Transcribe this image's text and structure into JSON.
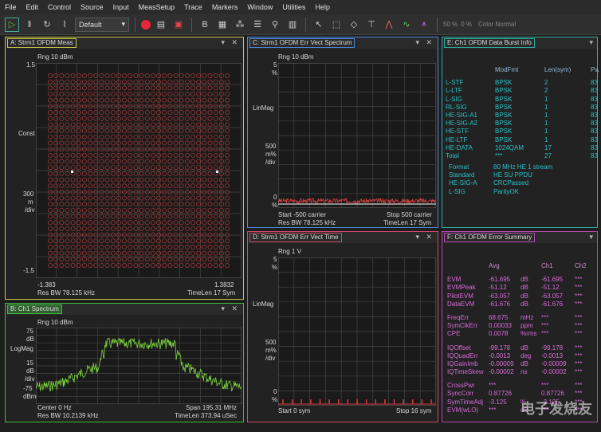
{
  "menu": [
    "File",
    "Edit",
    "Control",
    "Source",
    "Input",
    "MeasSetup",
    "Trace",
    "Markers",
    "Window",
    "Utilities",
    "Help"
  ],
  "toolbar": {
    "preset": "Default",
    "zoom": "50 %",
    "zoom2": "0 %",
    "color": "Color Normal"
  },
  "panelA": {
    "title": "A: Strm1 OFDM Meas",
    "rng": "Rng 10 dBm",
    "y_top": "1.5",
    "y_mid_label": "Const",
    "y_scale1": "300",
    "y_scale2": "m",
    "y_scale3": "/div",
    "y_bot": "-1.5",
    "x_left": "-1.383",
    "x_right": "1.3832",
    "bottom_left": "Res BW 78.125 kHz",
    "bottom_right": "TimeLen 17  Sym"
  },
  "panelB": {
    "title": "B: Ch1 Spectrum",
    "rng": "Rng 10 dBm",
    "y_top": "75",
    "y_top2": "dB",
    "y_mid": "LogMag",
    "y_3": "15",
    "y_4": "dB",
    "y_5": "/div",
    "y_bot": "-75",
    "y_bot2": "dBm",
    "bottom_l1": "Center 0  Hz",
    "bottom_l2": "Res BW 10.2139 kHz",
    "bottom_r1": "Span 195.31 MHz",
    "bottom_r2": "TimeLen 373.94 uSec"
  },
  "panelC": {
    "title": "C: Strm1 OFDM Err Vect Spectrum",
    "rng": "Rng 10 dBm",
    "y_top": "5",
    "y_top2": "%",
    "y_mid": "LinMag",
    "y_3": "500",
    "y_4": "m%",
    "y_5": "/div",
    "y_bot": "0",
    "y_bot2": "%",
    "bl1": "Start -500  carrier",
    "bl2": "Res BW 78.125 kHz",
    "br1": "Stop 500  carrier",
    "br2": "TimeLen 17  Sym"
  },
  "panelD": {
    "title": "D: Strm1 OFDM Err Vect Time",
    "rng": "Rng 1  V",
    "y_top": "5",
    "y_top2": "%",
    "y_mid": "LinMag",
    "y_3": "500",
    "y_4": "m%",
    "y_5": "/div",
    "y_bot": "0",
    "y_bot2": "%",
    "bl": "Start 0  sym",
    "br": "Stop 16  sym"
  },
  "panelE": {
    "title": "E: Ch1 OFDM Data Burst Info",
    "headers": [
      "",
      "ModFmt",
      "Len(sym)",
      "Pw"
    ],
    "rows": [
      [
        "L-STF",
        "BPSK",
        "2",
        "83"
      ],
      [
        "L-LTF",
        "BPSK",
        "2",
        "83"
      ],
      [
        "L-SIG",
        "BPSK",
        "1",
        "83"
      ],
      [
        "RL-SIG",
        "BPSK",
        "1",
        "83"
      ],
      [
        "HE-SIG-A1",
        "BPSK",
        "1",
        "83"
      ],
      [
        "HE-SIG-A2",
        "BPSK",
        "1",
        "83"
      ],
      [
        "HE-STF",
        "BPSK",
        "1",
        "83"
      ],
      [
        "HE-LTF",
        "BPSK",
        "1",
        "83"
      ],
      [
        "HE-DATA",
        "1024QAM",
        "17",
        "83"
      ],
      [
        "Total",
        "***",
        "27",
        "83"
      ]
    ],
    "info": [
      [
        "Format",
        "80  MHz HE 1  stream"
      ],
      [
        "Standard",
        "HE SU PPDU"
      ],
      [
        "HE-SIG-A",
        "CRCPassed"
      ],
      [
        "L-SIG",
        "ParityOK"
      ]
    ]
  },
  "panelF": {
    "title": "F: Ch1 OFDM Error Summary",
    "headers": [
      "",
      "Avg",
      "",
      "Ch1",
      "Ch2"
    ],
    "groups": [
      [
        [
          "EVM",
          "-61.695",
          "dB",
          "-61.695",
          "***"
        ],
        [
          "EVMPeak",
          "-51.12",
          "dB",
          "-51.12",
          "***"
        ],
        [
          "PilotEVM",
          "-63.057",
          "dB",
          "-63.057",
          "***"
        ],
        [
          "DataEVM",
          "-61.676",
          "dB",
          "-61.676",
          "***"
        ]
      ],
      [
        [
          "FreqErr",
          "68.675",
          "mHz",
          "***",
          "***"
        ],
        [
          "SymClkErr",
          "0.00033",
          "ppm",
          "***",
          "***"
        ],
        [
          "CPE",
          "0.0078",
          "%rms",
          "***",
          "***"
        ]
      ],
      [
        [
          "IQOffset",
          "-99.178",
          "dB",
          "-99.178",
          "***"
        ],
        [
          "IQQuadErr",
          "-0.0013",
          "deg",
          "-0.0013",
          "***"
        ],
        [
          "IQGainImb",
          "-0.00009",
          "dB",
          "-0.00009",
          "***"
        ],
        [
          "IQTimeSkew",
          "-0.00002",
          "ns",
          "-0.00002",
          "***"
        ]
      ],
      [
        [
          "CrossPwr",
          "***",
          "",
          "***",
          "***"
        ],
        [
          "SyncCorr",
          "0.87726",
          "",
          "0.87726",
          "***"
        ],
        [
          "SymTimeAdj",
          "-3.125",
          "%",
          "-3.125",
          "***"
        ],
        [
          "EVM(wLO)",
          "***",
          "dB",
          "***",
          "***"
        ]
      ]
    ]
  },
  "watermark": "电子发烧友"
}
